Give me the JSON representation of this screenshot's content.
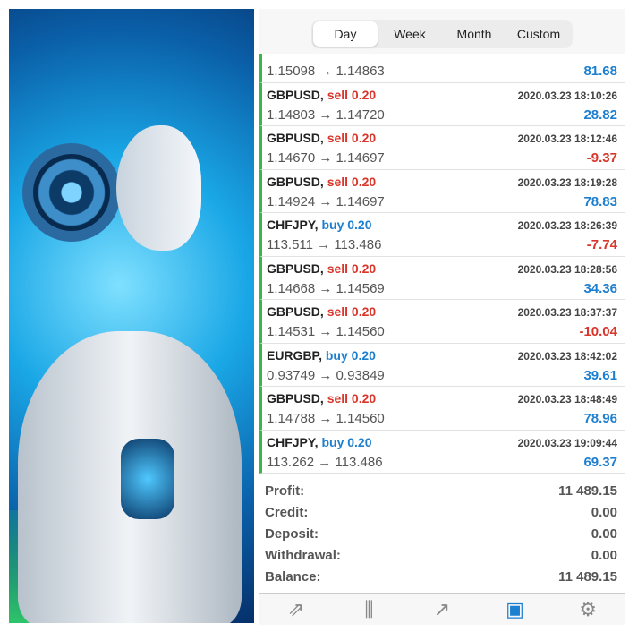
{
  "tabs": [
    "Day",
    "Week",
    "Month",
    "Custom"
  ],
  "first_row": {
    "prices": "1.15098 → 1.14863",
    "profit": "81.68"
  },
  "deals": [
    {
      "symbol": "GBPUSD,",
      "side": "sell 0.20",
      "type": "sell",
      "time": "2020.03.23 18:10:26",
      "prices": "1.14803 → 1.14720",
      "profit": "28.82"
    },
    {
      "symbol": "GBPUSD,",
      "side": "sell 0.20",
      "type": "sell",
      "time": "2020.03.23 18:12:46",
      "prices": "1.14670 → 1.14697",
      "profit": "-9.37"
    },
    {
      "symbol": "GBPUSD,",
      "side": "sell 0.20",
      "type": "sell",
      "time": "2020.03.23 18:19:28",
      "prices": "1.14924 → 1.14697",
      "profit": "78.83"
    },
    {
      "symbol": "CHFJPY,",
      "side": "buy 0.20",
      "type": "buy",
      "time": "2020.03.23 18:26:39",
      "prices": "113.511 → 113.486",
      "profit": "-7.74"
    },
    {
      "symbol": "GBPUSD,",
      "side": "sell 0.20",
      "type": "sell",
      "time": "2020.03.23 18:28:56",
      "prices": "1.14668 → 1.14569",
      "profit": "34.36"
    },
    {
      "symbol": "GBPUSD,",
      "side": "sell 0.20",
      "type": "sell",
      "time": "2020.03.23 18:37:37",
      "prices": "1.14531 → 1.14560",
      "profit": "-10.04"
    },
    {
      "symbol": "EURGBP,",
      "side": "buy 0.20",
      "type": "buy",
      "time": "2020.03.23 18:42:02",
      "prices": "0.93749 → 0.93849",
      "profit": "39.61"
    },
    {
      "symbol": "GBPUSD,",
      "side": "sell 0.20",
      "type": "sell",
      "time": "2020.03.23 18:48:49",
      "prices": "1.14788 → 1.14560",
      "profit": "78.96"
    },
    {
      "symbol": "CHFJPY,",
      "side": "buy 0.20",
      "type": "buy",
      "time": "2020.03.23 19:09:44",
      "prices": "113.262 → 113.486",
      "profit": "69.37"
    }
  ],
  "summary": [
    {
      "label": "Profit:",
      "value": "11 489.15"
    },
    {
      "label": "Credit:",
      "value": "0.00"
    },
    {
      "label": "Deposit:",
      "value": "0.00"
    },
    {
      "label": "Withdrawal:",
      "value": "0.00"
    },
    {
      "label": "Balance:",
      "value": "11 489.15"
    }
  ],
  "bottom_tabs": [
    {
      "icon": "quotes-arrows-icon",
      "glyph": "⇗"
    },
    {
      "icon": "candlestick-chart-icon",
      "glyph": "⫼"
    },
    {
      "icon": "trade-chart-icon",
      "glyph": "↗"
    },
    {
      "icon": "history-inbox-icon",
      "glyph": "▣",
      "active": true
    },
    {
      "icon": "settings-gear-icon",
      "glyph": "⚙"
    }
  ],
  "colors": {
    "sell": "#d9352a",
    "buy": "#1d7fd0",
    "positive": "#1d7fd0",
    "negative": "#d9352a",
    "active_tab": "#1d7fd0"
  }
}
